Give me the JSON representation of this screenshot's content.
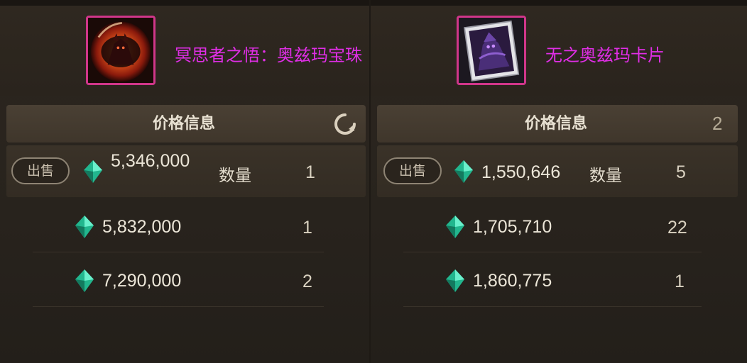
{
  "left": {
    "item_name": "冥思者之悟：奥兹玛宝珠",
    "price_header": "价格信息",
    "rows": [
      {
        "price": "5,346,000",
        "qty": "1",
        "qty_label": "数量",
        "sell_label": "出售"
      },
      {
        "price": "5,832,000",
        "qty": "1"
      },
      {
        "price": "7,290,000",
        "qty": "2"
      }
    ]
  },
  "right": {
    "item_name": "无之奥兹玛卡片",
    "price_header": "价格信息",
    "header_count": "2",
    "rows": [
      {
        "price": "1,550,646",
        "qty": "5",
        "qty_label": "数量",
        "sell_label": "出售"
      },
      {
        "price": "1,705,710",
        "qty": "22"
      },
      {
        "price": "1,860,775",
        "qty": "1"
      }
    ]
  },
  "colors": {
    "item_name": "#e02ee6",
    "icon_border": "#d0368a",
    "gem": "#2fd6a8"
  },
  "icons": [
    "eye-orb-icon",
    "ozma-card-icon",
    "refresh-icon",
    "gem-icon"
  ]
}
